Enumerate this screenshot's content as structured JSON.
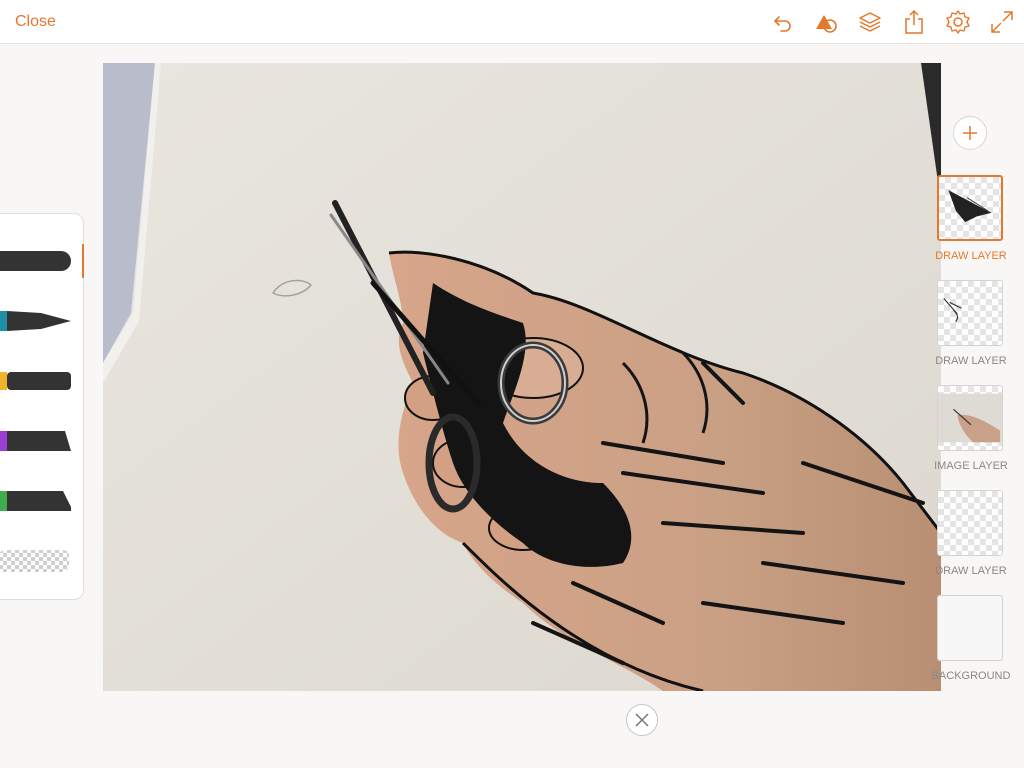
{
  "topbar": {
    "close_label": "Close",
    "icons": [
      "undo-icon",
      "shapes-icon",
      "layers-icon",
      "share-icon",
      "settings-icon",
      "fullscreen-icon"
    ]
  },
  "colors": {
    "accent": "#e4782c",
    "brush_blue": "#1f8fa8",
    "brush_yellow": "#f0b429",
    "brush_purple": "#9b3fd0",
    "brush_green": "#3fae4a"
  },
  "brushes": [
    {
      "name": "round-brush",
      "selected": true
    },
    {
      "name": "pen-brush",
      "color": "#1f8fa8"
    },
    {
      "name": "marker-brush",
      "color": "#f0b429"
    },
    {
      "name": "chisel-brush",
      "color": "#9b3fd0"
    },
    {
      "name": "flat-brush",
      "color": "#3fae4a"
    },
    {
      "name": "eraser-brush"
    }
  ],
  "layers": [
    {
      "label": "DRAW LAYER",
      "selected": true
    },
    {
      "label": "DRAW LAYER",
      "selected": false
    },
    {
      "label": "IMAGE LAYER",
      "selected": false
    },
    {
      "label": "DRAW LAYER",
      "selected": false
    },
    {
      "label": "BACKGROUND",
      "selected": false
    }
  ],
  "canvas": {
    "content": "photo of hand holding scissors with black ink drawing overlay"
  }
}
